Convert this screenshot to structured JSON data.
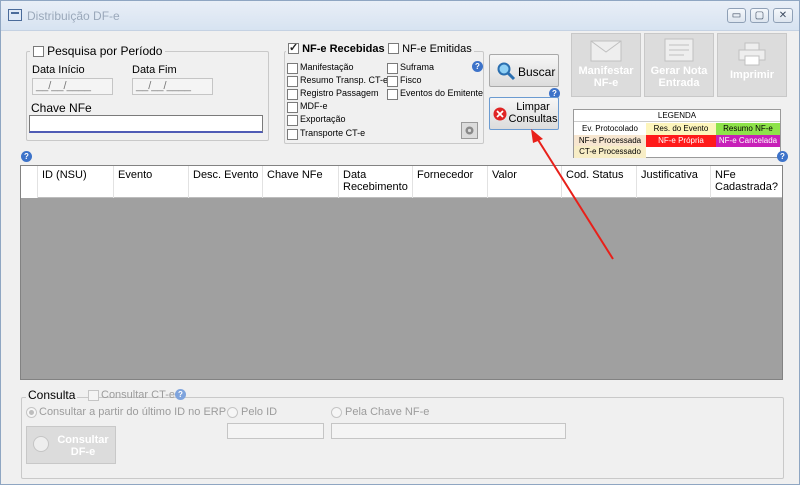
{
  "window": {
    "title": "Distribuição DF-e",
    "min": "▭",
    "max": "▢",
    "close": "✕"
  },
  "period": {
    "checkbox_label": "Pesquisa por Período",
    "start_label": "Data Início",
    "end_label": "Data Fim",
    "start_value": "__/__/____",
    "end_value": "__/__/____"
  },
  "chave": {
    "label": "Chave NFe",
    "value": ""
  },
  "nfe": {
    "recebidas": "NF-e Recebidas",
    "emitidas": "NF-e Emitidas",
    "options_left": [
      "Manifestação",
      "Resumo Transp. CT-e",
      "Registro Passagem",
      "MDF-e",
      "Exportação",
      "Transporte CT-e"
    ],
    "options_right": [
      "Suframa",
      "Fisco",
      "Eventos do Emitente"
    ]
  },
  "buttons": {
    "buscar": "Buscar",
    "limpar": "Limpar Consultas",
    "manifestar": "Manifestar NF-e",
    "gerar": "Gerar Nota Entrada",
    "imprimir": "Imprimir",
    "consultar": "Consultar DF-e"
  },
  "legend": {
    "title": "LEGENDA",
    "items": [
      {
        "label": "Ev. Protocolado",
        "color": "#ffffff"
      },
      {
        "label": "Res. do Evento",
        "color": "#fdf5bb"
      },
      {
        "label": "Resumo NF-e",
        "color": "#8ee34a"
      },
      {
        "label": "NF-e Processada",
        "color": "#f7e6d0"
      },
      {
        "label": "NF-e Própria",
        "color": "#ff1a1a"
      },
      {
        "label": "NF-e Cancelada",
        "color": "#c71fb8"
      },
      {
        "label": "CT-e Processado",
        "color": "#f7edc6"
      }
    ]
  },
  "grid": {
    "columns": [
      "ID (NSU)",
      "Evento",
      "Desc. Evento",
      "Chave NFe",
      "Data Recebimento",
      "Fornecedor",
      "Valor",
      "Cod. Status",
      "Justificativa",
      "NFe Cadastrada?"
    ]
  },
  "consulta": {
    "title": "Consulta",
    "consultar_cte": "Consultar CT-e",
    "radio_ultimo": "Consultar a partir do último ID no ERP",
    "radio_id": "Pelo ID",
    "radio_chave": "Pela Chave NF-e",
    "id_value": "",
    "chave_value": ""
  },
  "colors": {
    "help": "#3d73c9",
    "arrow": "#e8201a",
    "grid_bg": "#a0a0a0"
  },
  "icons": {
    "search": "search-icon",
    "clear": "clear-icon",
    "settings": "gear-icon"
  }
}
